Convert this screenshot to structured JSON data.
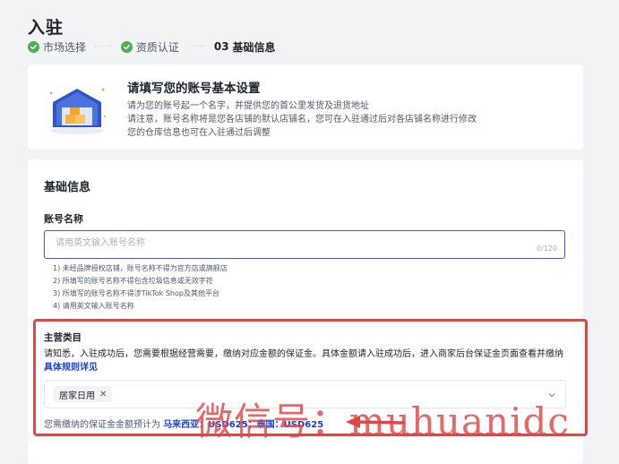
{
  "page": {
    "title": "入驻"
  },
  "steps": [
    {
      "label": "市场选择",
      "status": "done"
    },
    {
      "label": "资质认证",
      "status": "done"
    },
    {
      "num": "03",
      "label": "基础信息",
      "status": "active"
    }
  ],
  "intro": {
    "title": "请填写您的账号基本设置",
    "lines": [
      "请为您的账号起一个名字，并提供您的首公里发货及退货地址",
      "请注意，账号名称将是您各店铺的默认店铺名，您可在入驻通过后对各店铺名称进行修改",
      "您的仓库信息也可在入驻通过后调整"
    ]
  },
  "basic_info": {
    "title": "基础信息",
    "account_name": {
      "label": "账号名称",
      "placeholder": "请用英文输入账号名称",
      "counter": "0/120",
      "rules": [
        "1) 未经品牌授权店铺，账号名称不得为官方店或旗舰店",
        "2) 所填写的账号名称不得包含垃圾信息或无效字符",
        "3) 所填写的账号名称不得涉TikTok Shop及其他平台",
        "4) 请用英文输入账号名称"
      ]
    },
    "main_category": {
      "label": "主营类目",
      "note": "请知悉，入驻成功后，您需要根据经营需要，缴纳对应金额的保证金。具体金额请入驻成功后，进入商家后台保证金页面查看并缴纳",
      "link_text": "具体规则详见",
      "selected_tag": "居家日用",
      "deposit_prefix": "您需缴纳的保证金金额预计为",
      "deposit_amount": "马来西亚：USD625；泰国：USD625"
    }
  },
  "watermark": {
    "text": "微信号：muhuanidc"
  },
  "colors": {
    "accent": "#1a3ed1",
    "success": "#4caf50",
    "highlight_box": "#d84a4a"
  }
}
